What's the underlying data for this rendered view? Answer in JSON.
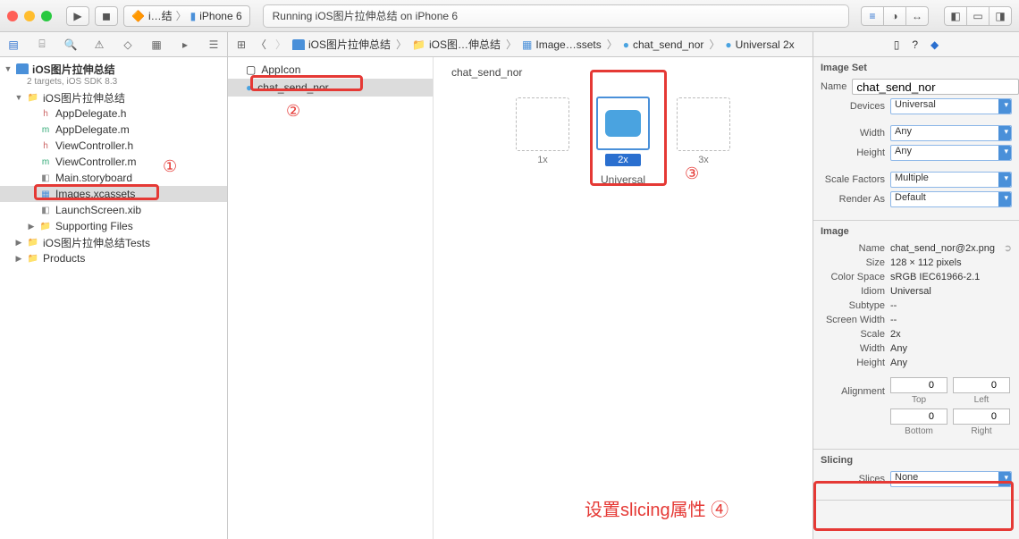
{
  "titlebar": {
    "scheme_app": "i…结",
    "scheme_device": "iPhone 6",
    "status": "Running iOS图片拉伸总结 on iPhone 6"
  },
  "breadcrumbs": [
    "iOS图片拉伸总结",
    "iOS图…伸总结",
    "Image…ssets",
    "chat_send_nor",
    "Universal 2x"
  ],
  "navigator": {
    "project": "iOS图片拉伸总结",
    "subtitle": "2 targets, iOS SDK 8.3",
    "group": "iOS图片拉伸总结",
    "files": [
      "AppDelegate.h",
      "AppDelegate.m",
      "ViewController.h",
      "ViewController.m",
      "Main.storyboard",
      "Images.xcassets",
      "LaunchScreen.xib"
    ],
    "supporting": "Supporting Files",
    "tests": "iOS图片拉伸总结Tests",
    "products": "Products"
  },
  "assetlist": {
    "items": [
      "AppIcon",
      "chat_send_nor"
    ]
  },
  "canvas": {
    "title": "chat_send_nor",
    "scales": [
      "1x",
      "2x",
      "3x"
    ],
    "universal": "Universal"
  },
  "inspector": {
    "imageset": {
      "header": "Image Set",
      "name_label": "Name",
      "name_value": "chat_send_nor",
      "devices_label": "Devices",
      "devices_value": "Universal",
      "width_label": "Width",
      "width_value": "Any",
      "height_label": "Height",
      "height_value": "Any",
      "scalefactors_label": "Scale Factors",
      "scalefactors_value": "Multiple",
      "renderas_label": "Render As",
      "renderas_value": "Default"
    },
    "image": {
      "header": "Image",
      "name_label": "Name",
      "name_value": "chat_send_nor@2x.png",
      "size_label": "Size",
      "size_value": "128 × 112 pixels",
      "colorspace_label": "Color Space",
      "colorspace_value": "sRGB IEC61966-2.1",
      "idiom_label": "Idiom",
      "idiom_value": "Universal",
      "subtype_label": "Subtype",
      "subtype_value": "--",
      "screenwidth_label": "Screen Width",
      "screenwidth_value": "--",
      "scale_label": "Scale",
      "scale_value": "2x",
      "width_label": "Width",
      "width_value": "Any",
      "height_label": "Height",
      "height_value": "Any",
      "alignment_label": "Alignment",
      "top": "Top",
      "left": "Left",
      "bottom": "Bottom",
      "right": "Right",
      "zero": "0"
    },
    "slicing": {
      "header": "Slicing",
      "slices_label": "Slices",
      "slices_value": "None"
    }
  },
  "annotations": {
    "n1": "①",
    "n2": "②",
    "n3": "③",
    "n4": "④",
    "text": "设置slicing属性"
  }
}
